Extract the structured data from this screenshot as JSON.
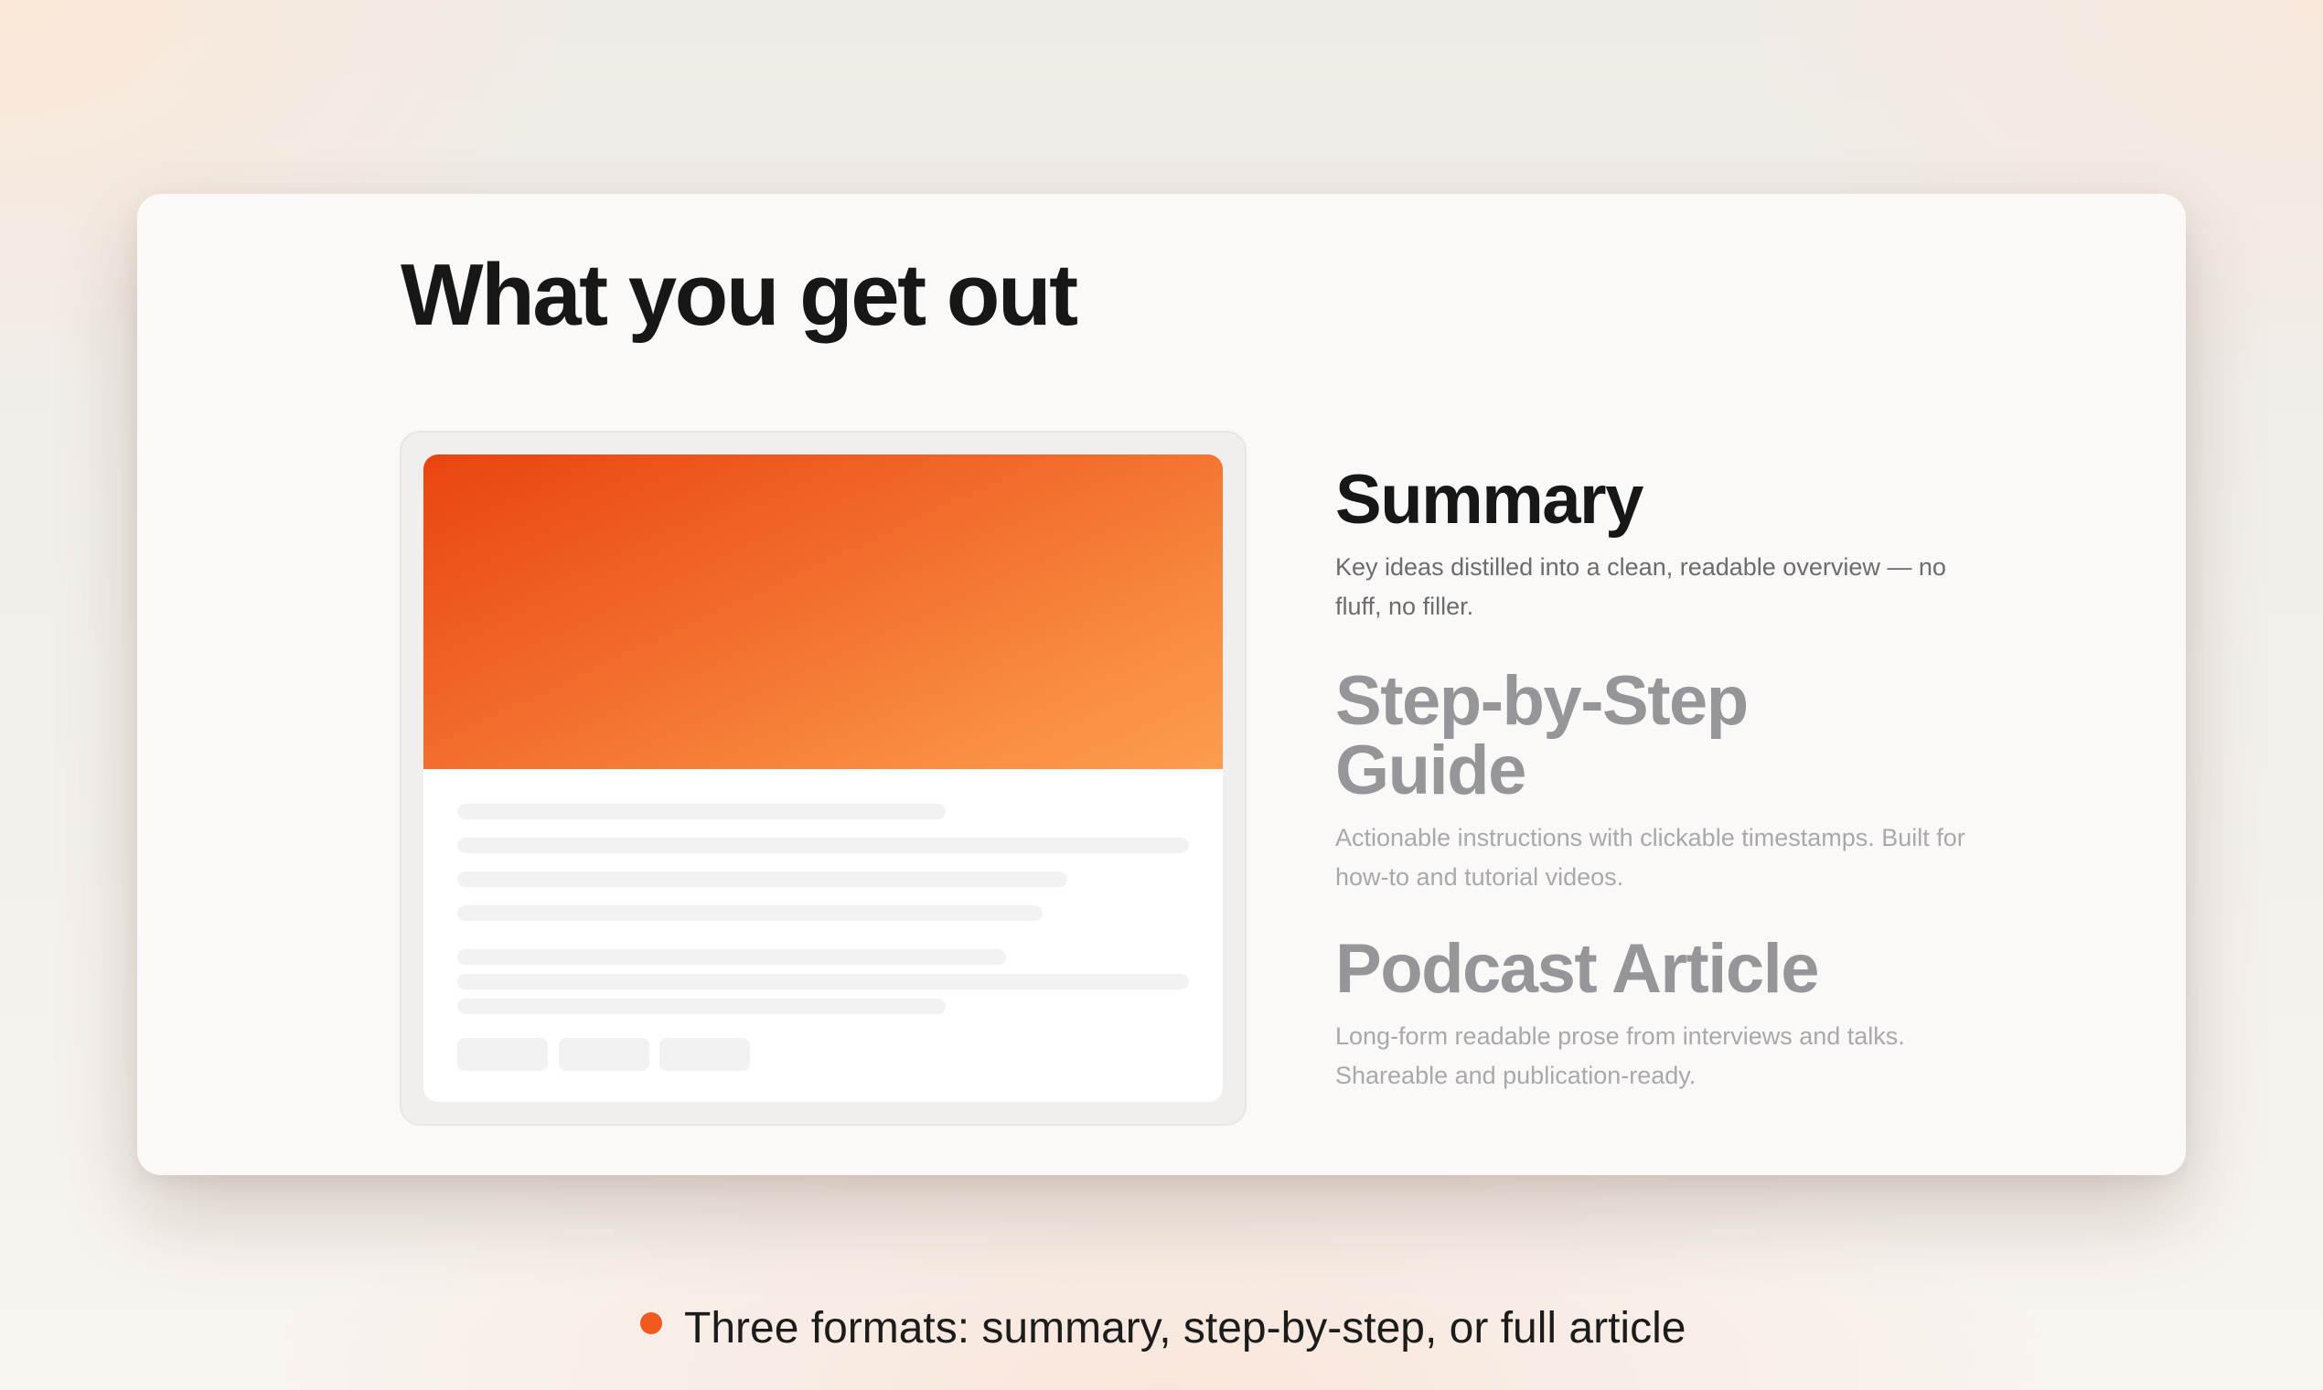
{
  "page": {
    "title": "What you get out"
  },
  "formats": [
    {
      "title": "Summary",
      "description": "Key ideas distilled into a clean, readable overview — no fluff, no filler.",
      "state": "active"
    },
    {
      "title": "Step-by-Step Guide",
      "description": "Actionable instructions with clickable timestamps. Built for how-to and tutorial videos.",
      "state": "dim"
    },
    {
      "title": "Podcast Article",
      "description": "Long-form readable prose from interviews and talks. Shareable and publication-ready.",
      "state": "dim"
    }
  ],
  "caption": {
    "text": "Three formats: summary, step-by-step, or full article"
  },
  "colors": {
    "accent": "#f05a1f",
    "hero_gradient_start": "#e94411",
    "hero_gradient_end": "#fd9d4c",
    "title_text": "#171717",
    "muted_text": "#96959a"
  }
}
